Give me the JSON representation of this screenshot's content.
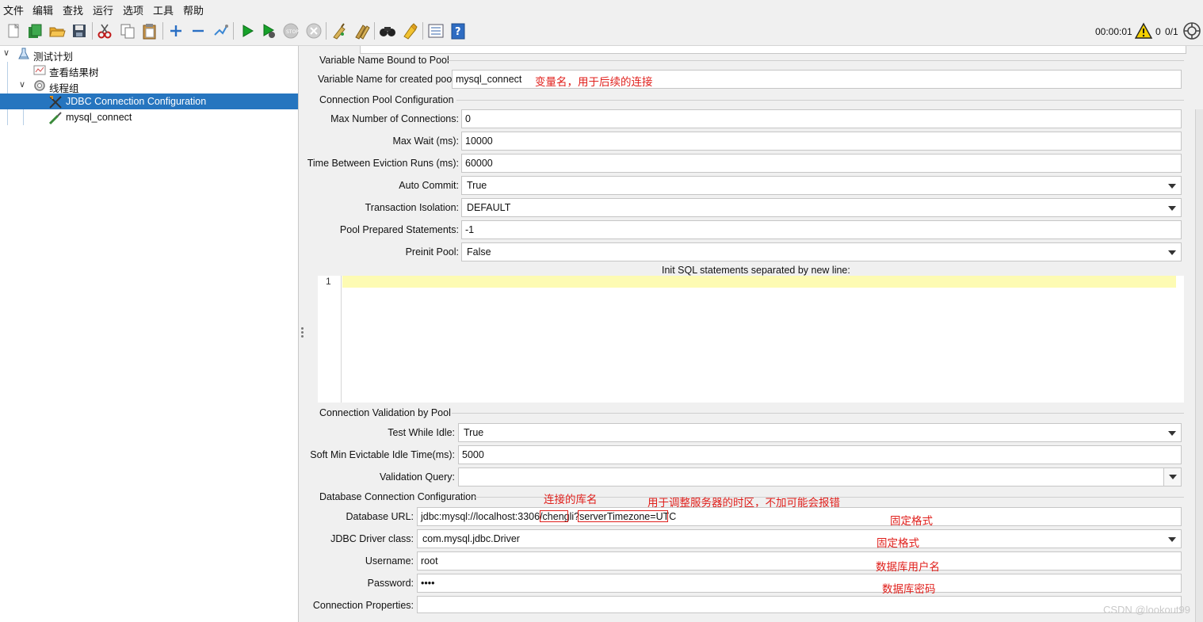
{
  "menu": [
    "文件",
    "编辑",
    "查找",
    "运行",
    "选项",
    "工具",
    "帮助"
  ],
  "toolbar": {
    "icons": [
      "new-icon",
      "templates-icon",
      "open-icon",
      "save-icon",
      "cut-icon",
      "copy-icon",
      "paste-icon",
      "expand-icon",
      "collapse-icon",
      "toggle-icon",
      "start-icon",
      "start-no-pause-icon",
      "stop-icon",
      "shutdown-icon",
      "clear-icon",
      "clear-all-icon",
      "search-icon",
      "reset-search-icon",
      "function-helper-icon",
      "help-icon"
    ],
    "timer": "00:00:01",
    "warning_count": "0",
    "threads": "0/1"
  },
  "tree": {
    "items": [
      {
        "label": "测试计划",
        "icon": "test-plan-icon"
      },
      {
        "label": "查看结果树",
        "icon": "listener-icon"
      },
      {
        "label": "线程组",
        "icon": "thread-group-icon"
      },
      {
        "label": "JDBC Connection Configuration",
        "icon": "config-element-icon"
      },
      {
        "label": "mysql_connect",
        "icon": "sampler-icon"
      }
    ]
  },
  "form": {
    "var_section": "Variable Name Bound to Pool",
    "var_label": "Variable Name for created pool:",
    "var_value": "mysql_connect",
    "pool_section": "Connection Pool Configuration",
    "max_conn_label": "Max Number of Connections:",
    "max_conn_value": "0",
    "max_wait_label": "Max Wait (ms):",
    "max_wait_value": "10000",
    "eviction_label": "Time Between Eviction Runs (ms):",
    "eviction_value": "60000",
    "auto_commit_label": "Auto Commit:",
    "auto_commit_value": "True",
    "isolation_label": "Transaction Isolation:",
    "isolation_value": "DEFAULT",
    "prepared_label": "Pool Prepared Statements:",
    "prepared_value": "-1",
    "preinit_label": "Preinit Pool:",
    "preinit_value": "False",
    "init_sql_label": "Init SQL statements separated by new line:",
    "init_sql_line": "1",
    "validation_section": "Connection Validation by Pool",
    "test_idle_label": "Test While Idle:",
    "test_idle_value": "True",
    "soft_min_label": "Soft Min Evictable Idle Time(ms):",
    "soft_min_value": "5000",
    "validation_query_label": "Validation Query:",
    "validation_query_value": "",
    "db_section": "Database Connection Configuration",
    "db_url_label": "Database URL:",
    "db_url_value": "jdbc:mysql://localhost:3306/chengli?serverTimezone=UTC",
    "driver_label": "JDBC Driver class:",
    "driver_value": "com.mysql.jdbc.Driver",
    "username_label": "Username:",
    "username_value": "root",
    "password_label": "Password:",
    "password_value": "••••",
    "props_label": "Connection Properties:",
    "props_value": ""
  },
  "annotations": {
    "var_name": "变量名，用于后续的连接",
    "db_name": "连接的库名",
    "timezone": "用于调整服务器的时区，不加可能会报错",
    "fixed_format_1": "固定格式",
    "fixed_format_2": "固定格式",
    "db_user": "数据库用户名",
    "db_password": "数据库密码"
  },
  "watermark": "CSDN @lookout99",
  "colors": {
    "selection": "#2675bf",
    "annotation": "#e0201c",
    "editor_line": "#fdfbb3"
  }
}
